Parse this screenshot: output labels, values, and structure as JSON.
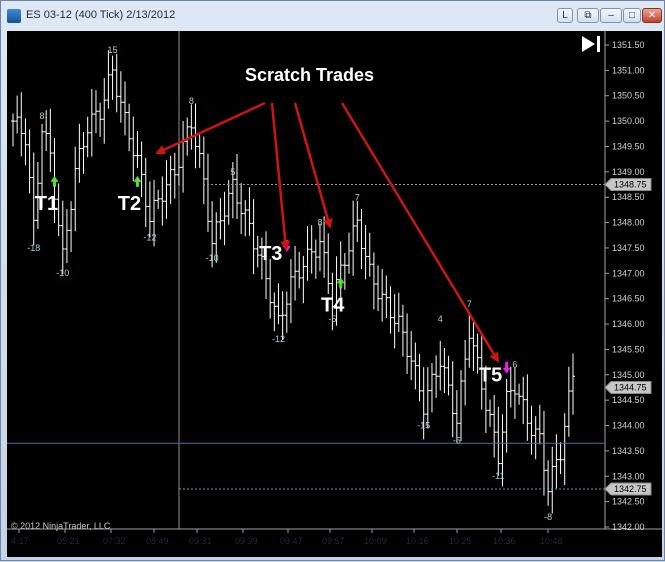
{
  "window": {
    "title": "ES 03-12 (400 Tick)  2/13/2012",
    "buttons": {
      "log": "L",
      "restore_down": "⧉",
      "minimize": "–",
      "maximize": "□",
      "close": "✕"
    }
  },
  "chart": {
    "copyright": "© 2012 NinjaTrader, LLC",
    "scratch_label": "Scratch Trades",
    "colors": {
      "background": "#000000",
      "bars": "#ffffff",
      "long_arrow": "#55e02a",
      "short_arrow": "#e81ee8",
      "annotation_arrow": "#cc1515",
      "swing_label": "#9fd6d2",
      "h_line_blue": "#4d6fa0"
    }
  },
  "chart_data": {
    "type": "ohlc",
    "y_axis_labels": [
      "1351.50",
      "1351.00",
      "1350.50",
      "1350.00",
      "1349.50",
      "1349.00",
      "1348.50",
      "1348.00",
      "1347.50",
      "1347.00",
      "1346.50",
      "1346.00",
      "1345.50",
      "1345.00",
      "1344.50",
      "1344.00",
      "1343.50",
      "1343.00",
      "1342.50",
      "1342.00"
    ],
    "ylim": [
      1342.0,
      1351.5
    ],
    "x_axis_labels": [
      "4:17",
      "05:21",
      "07:32",
      "08:49",
      "09:31",
      "09:39",
      "09:47",
      "09:57",
      "10:09",
      "10:16",
      "10:25",
      "10:36",
      "10:48"
    ],
    "price_markers": [
      {
        "label": "1348.75",
        "value": 1348.75,
        "style": "dotted-gray"
      },
      {
        "label": "1344.75",
        "value": 1344.75,
        "style": "solid"
      },
      {
        "label": "1342.75",
        "value": 1342.75,
        "style": "dotted-teal"
      }
    ],
    "horizontal_lines": [
      {
        "value": 1343.65,
        "color": "blue"
      }
    ],
    "swing_labels": [
      {
        "text": "8",
        "bar": 7,
        "value": 1350.0,
        "pos": "above"
      },
      {
        "text": "-18",
        "bar": 5,
        "value": 1347.6,
        "pos": "below"
      },
      {
        "text": "-10",
        "bar": 12,
        "value": 1347.1,
        "pos": "below"
      },
      {
        "text": "15",
        "bar": 24,
        "value": 1351.3,
        "pos": "above"
      },
      {
        "text": "-12",
        "bar": 33,
        "value": 1347.8,
        "pos": "below"
      },
      {
        "text": "8",
        "bar": 43,
        "value": 1350.3,
        "pos": "above"
      },
      {
        "text": "5",
        "bar": 53,
        "value": 1348.9,
        "pos": "above"
      },
      {
        "text": "-10",
        "bar": 48,
        "value": 1347.4,
        "pos": "below"
      },
      {
        "text": "-12",
        "bar": 64,
        "value": 1345.8,
        "pos": "below"
      },
      {
        "text": "8",
        "bar": 74,
        "value": 1347.9,
        "pos": "above"
      },
      {
        "text": "-5",
        "bar": 77,
        "value": 1346.2,
        "pos": "below"
      },
      {
        "text": "7",
        "bar": 83,
        "value": 1348.4,
        "pos": "above"
      },
      {
        "text": "4",
        "bar": 103,
        "value": 1346.0,
        "pos": "above"
      },
      {
        "text": "-15",
        "bar": 99,
        "value": 1344.1,
        "pos": "below"
      },
      {
        "text": "7",
        "bar": 110,
        "value": 1346.3,
        "pos": "above"
      },
      {
        "text": "-5",
        "bar": 107,
        "value": 1343.8,
        "pos": "below"
      },
      {
        "text": "-11",
        "bar": 117,
        "value": 1343.1,
        "pos": "below"
      },
      {
        "text": "6",
        "bar": 121,
        "value": 1345.1,
        "pos": "above"
      },
      {
        "text": "-8",
        "bar": 129,
        "value": 1342.3,
        "pos": "below"
      }
    ],
    "trades": [
      {
        "label": "T1",
        "direction": "long",
        "entry_bar": 10,
        "value": 1349.0
      },
      {
        "label": "T2",
        "direction": "long",
        "entry_bar": 30,
        "value": 1349.0
      },
      {
        "label": "T3",
        "direction": "short",
        "entry_bar": 66,
        "value": 1347.5
      },
      {
        "label": "T4",
        "direction": "long",
        "entry_bar": 79,
        "value": 1347.0
      },
      {
        "label": "T5",
        "direction": "short",
        "entry_bar": 119,
        "value": 1345.1
      }
    ],
    "annotation": {
      "text": "Scratch Trades",
      "targets": [
        "T2",
        "T3",
        "T4",
        "T5"
      ]
    }
  }
}
